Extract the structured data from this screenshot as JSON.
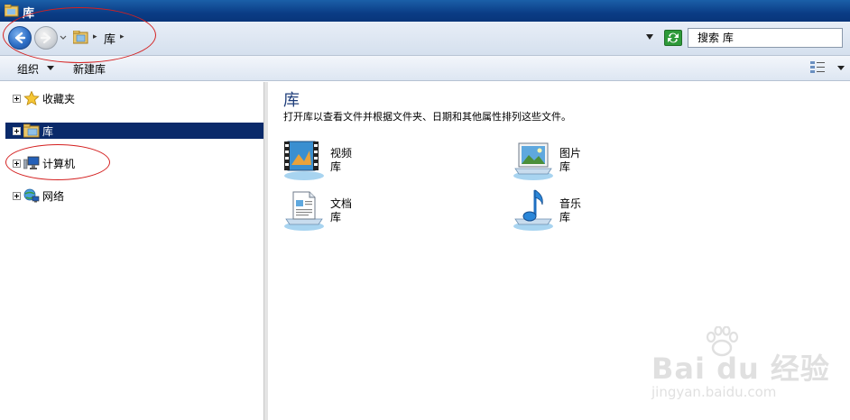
{
  "window": {
    "title": "库"
  },
  "address_bar": {
    "crumb": "库",
    "separator": "▸",
    "search_placeholder": "搜索 库"
  },
  "toolbar": {
    "organize_label": "组织",
    "new_library_label": "新建库"
  },
  "nav_tree": {
    "items": [
      {
        "label": "收藏夹",
        "icon": "star-icon",
        "selected": false
      },
      {
        "label": "库",
        "icon": "library-folder-icon",
        "selected": true
      },
      {
        "label": "计算机",
        "icon": "computer-icon",
        "selected": false
      },
      {
        "label": "网络",
        "icon": "network-icon",
        "selected": false
      }
    ]
  },
  "content": {
    "title": "库",
    "description": "打开库以查看文件并根据文件夹、日期和其他属性排列这些文件。",
    "libraries": [
      {
        "name_line1": "视频",
        "name_line2": "库",
        "icon": "video-library-icon"
      },
      {
        "name_line1": "图片",
        "name_line2": "库",
        "icon": "pictures-library-icon"
      },
      {
        "name_line1": "文档",
        "name_line2": "库",
        "icon": "documents-library-icon"
      },
      {
        "name_line1": "音乐",
        "name_line2": "库",
        "icon": "music-library-icon"
      }
    ]
  },
  "watermark": {
    "brand": "Bai du 经验",
    "url": "jingyan.baidu.com"
  },
  "colors": {
    "title_bar": "#0b3d86",
    "selection": "#0a2a6a",
    "annotation": "#d42020",
    "content_title": "#1e3d7a"
  }
}
